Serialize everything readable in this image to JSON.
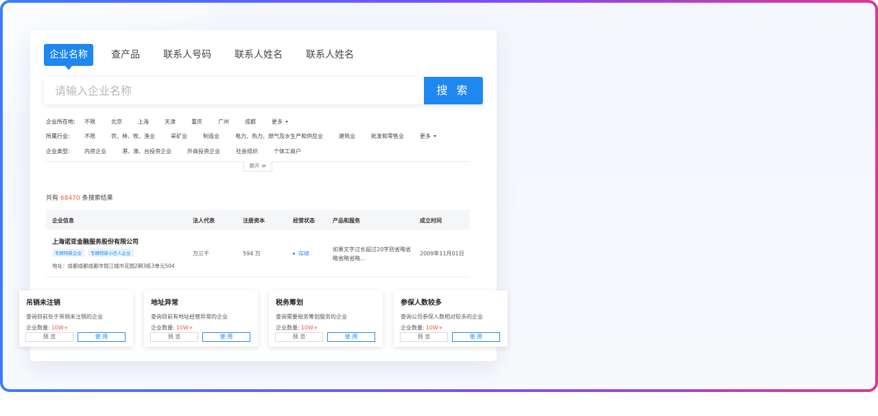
{
  "tabs": [
    {
      "label": "企业名称",
      "active": true
    },
    {
      "label": "查产品"
    },
    {
      "label": "联系人号码"
    },
    {
      "label": "联系人姓名"
    },
    {
      "label": "联系人姓名"
    }
  ],
  "search": {
    "placeholder": "请输入企业名称",
    "value": "",
    "button": "搜 索"
  },
  "filters": {
    "region": {
      "label": "企业所在地:",
      "options": [
        "不限",
        "北京",
        "上海",
        "天津",
        "重庆",
        "广州",
        "成都"
      ],
      "more": "更多"
    },
    "industry": {
      "label": "所属行业:",
      "options": [
        "不限",
        "农、林、牧、渔业",
        "采矿业",
        "制造业",
        "电力、热力、燃气及水生产和供应业",
        "建筑业",
        "批发和零售业"
      ],
      "more": "更多"
    },
    "type": {
      "label": "企业类型:",
      "options": [
        "内资企业",
        "港、澳、台投资企业",
        "外商投资企业",
        "社会组织",
        "个体工商户"
      ]
    },
    "expand": "展开 ≫"
  },
  "results": {
    "prefix": "共有",
    "count": "68470",
    "suffix": "条搜索结果"
  },
  "table": {
    "headers": [
      "企业信息",
      "法人代表",
      "注册资本",
      "经营状态",
      "产品和服务",
      "成立时间"
    ],
    "rows": [
      {
        "name": "上海诺亚金融服务股份有限公司",
        "tags": [
          "专精特新企业",
          "专精特新小巨人企业"
        ],
        "address": "地址：成都成都成都市锦江城市花园2期3栋3单元504",
        "rep": "万三千",
        "capital": "594 万",
        "status": "存续",
        "products_line1": "如果文字过长超过20字则省略省",
        "products_line2": "略省略省略...",
        "founded": "2009年11月01日"
      }
    ]
  },
  "cards": [
    {
      "title": "吊销未注销",
      "desc": "查询目前处于吊销未注销的企业",
      "count_label": "企业数量:",
      "count": "10W+",
      "preview": "预 览",
      "use": "使 用"
    },
    {
      "title": "地址异常",
      "desc": "查询目前有地址经营异常的企业",
      "count_label": "企业数量:",
      "count": "10W+",
      "preview": "预 览",
      "use": "使 用"
    },
    {
      "title": "税务筹划",
      "desc": "查询需要税务筹划服务的企业",
      "count_label": "企业数量:",
      "count": "10W+",
      "preview": "预 览",
      "use": "使 用"
    },
    {
      "title": "参保人数较多",
      "desc": "查询公司参保人数相对较多的企业",
      "count_label": "企业数量:",
      "count": "10W+",
      "preview": "预 览",
      "use": "使 用"
    }
  ],
  "colors": {
    "accent": "#1e87f0",
    "highlight": "#f0553c"
  }
}
